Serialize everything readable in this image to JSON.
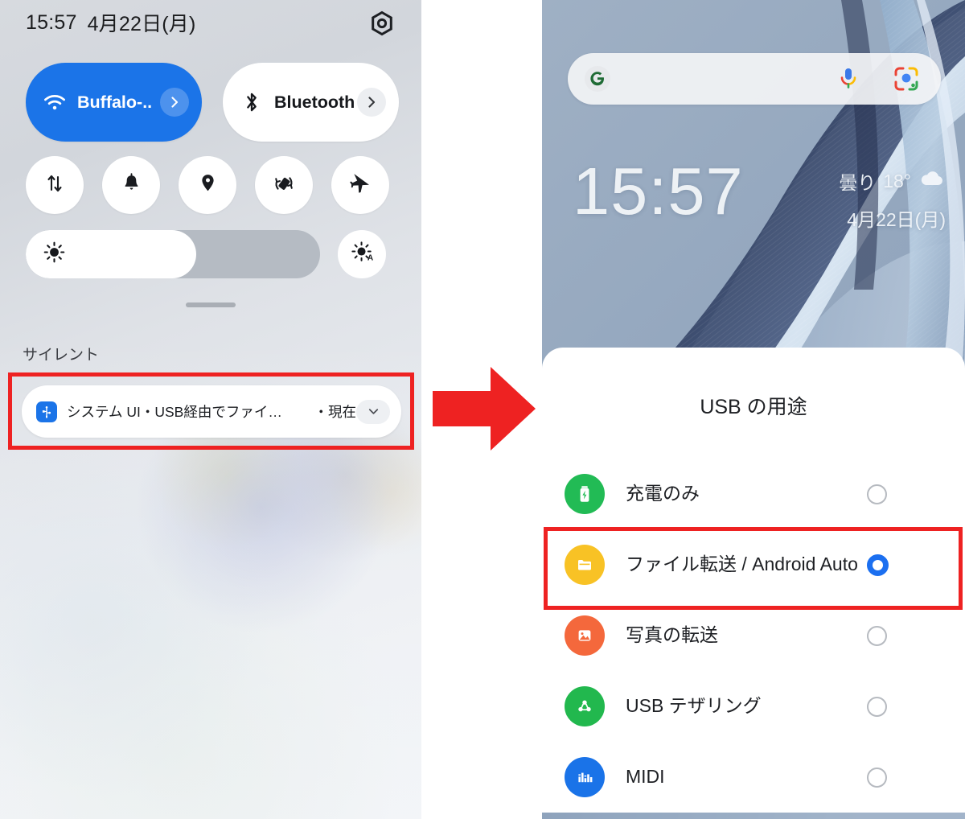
{
  "left_panel": {
    "status": {
      "time": "15:57",
      "date": "4月22日(月)"
    },
    "gear_icon": "settings-gear-icon",
    "big_tiles": [
      {
        "id": "wifi",
        "icon": "wifi-icon",
        "label": "Buffalo-..",
        "state": "on",
        "chevron": "chevron-right-icon"
      },
      {
        "id": "bluetooth",
        "icon": "bluetooth-icon",
        "label": "Bluetooth",
        "state": "off",
        "chevron": "chevron-right-icon"
      }
    ],
    "small_tiles": [
      {
        "id": "data-saver",
        "icon": "data-transfer-icon"
      },
      {
        "id": "ring-mode",
        "icon": "bell-icon"
      },
      {
        "id": "location",
        "icon": "location-pin-icon"
      },
      {
        "id": "auto-rotate",
        "icon": "screen-rotate-icon"
      },
      {
        "id": "airplane-mode",
        "icon": "airplane-icon"
      }
    ],
    "brightness": {
      "icon": "brightness-icon",
      "value_percent": 58,
      "auto_icon": "auto-brightness-icon"
    },
    "silent_section_label": "サイレント",
    "notification": {
      "app_icon": "usb-icon",
      "text": "システム UI・USB経由でファイ…",
      "time": "・現在",
      "expand_icon": "chevron-down-icon"
    }
  },
  "arrow": {
    "icon": "arrow-right-icon",
    "color": "#ee2222"
  },
  "right_panel": {
    "search": {
      "logo": "google-g-icon",
      "mic_icon": "microphone-icon",
      "lens_icon": "google-lens-icon",
      "placeholder": ""
    },
    "clock": "15:57",
    "weather": {
      "condition": "曇り",
      "temperature": "18°",
      "icon": "cloud-icon",
      "date": "4月22日(月)"
    },
    "usb_dialog": {
      "title": "USB の用途",
      "options": [
        {
          "id": "charge-only",
          "label": "充電のみ",
          "icon": "battery-charging-icon",
          "icon_color": "#22bb55",
          "selected": false
        },
        {
          "id": "file-transfer",
          "label": "ファイル転送 / Android Auto",
          "icon": "folder-icon",
          "icon_color": "#f8c225",
          "selected": true
        },
        {
          "id": "photo-transfer",
          "label": "写真の転送",
          "icon": "photo-image-icon",
          "icon_color": "#f4683c",
          "selected": false
        },
        {
          "id": "usb-tethering",
          "label": "USB テザリング",
          "icon": "tethering-share-icon",
          "icon_color": "#22b84e",
          "selected": false
        },
        {
          "id": "midi",
          "label": "MIDI",
          "icon": "midi-equalizer-icon",
          "icon_color": "#1a73e8",
          "selected": false
        }
      ]
    }
  },
  "colors": {
    "accent_blue": "#1b74e8",
    "highlight_red": "#ee2222",
    "radio_selected": "#1b6ff0"
  }
}
